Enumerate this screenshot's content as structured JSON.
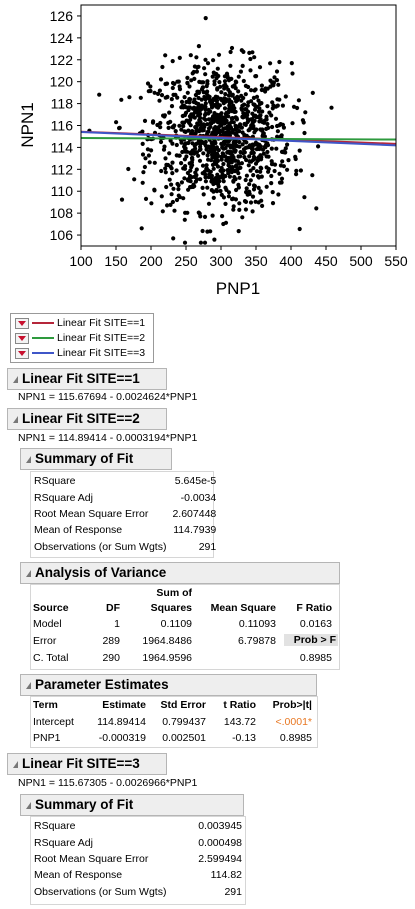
{
  "chart_data": {
    "type": "scatter",
    "xlabel": "PNP1",
    "ylabel": "NPN1",
    "xlim": [
      100,
      550
    ],
    "ylim": [
      105,
      127
    ],
    "x_ticks": [
      "100",
      "150",
      "200",
      "250",
      "300",
      "350",
      "400",
      "450",
      "500",
      "550"
    ],
    "y_ticks": [
      "106",
      "108",
      "110",
      "112",
      "114",
      "116",
      "118",
      "120",
      "122",
      "124",
      "126"
    ],
    "point_cloud": {
      "center_x": 300,
      "center_y": 115,
      "sd_x": 50,
      "sd_y": 3.3,
      "approx_points": 1100
    },
    "fit_lines": [
      {
        "name": "Linear Fit SITE==1",
        "color": "#b5263a",
        "intercept": 115.67694,
        "slope": -0.0024624
      },
      {
        "name": "Linear Fit SITE==2",
        "color": "#2e9a3e",
        "intercept": 114.89414,
        "slope": -0.0003194
      },
      {
        "name": "Linear Fit SITE==3",
        "color": "#3f56c8",
        "intercept": 115.67305,
        "slope": -0.0026966
      }
    ]
  },
  "legend": {
    "items": [
      {
        "label": "Linear Fit SITE==1",
        "color": "#b5263a"
      },
      {
        "label": "Linear Fit SITE==2",
        "color": "#2e9a3e"
      },
      {
        "label": "Linear Fit SITE==3",
        "color": "#3f56c8"
      }
    ]
  },
  "fit1": {
    "title": "Linear Fit SITE==1",
    "equation": "NPN1 = 115.67694 - 0.0024624*PNP1"
  },
  "fit2": {
    "title": "Linear Fit SITE==2",
    "equation": "NPN1 = 114.89414 - 0.0003194*PNP1",
    "summary": {
      "title": "Summary of Fit",
      "rows": [
        {
          "label": "RSquare",
          "value": "5.645e-5"
        },
        {
          "label": "RSquare Adj",
          "value": "-0.0034"
        },
        {
          "label": "Root Mean Square Error",
          "value": "2.607448"
        },
        {
          "label": "Mean of Response",
          "value": "114.7939"
        },
        {
          "label": "Observations (or Sum Wgts)",
          "value": "291"
        }
      ]
    },
    "anova": {
      "title": "Analysis of Variance",
      "headers": {
        "source": "Source",
        "df": "DF",
        "ss_top": "Sum of",
        "ss_bottom": "Squares",
        "ms": "Mean Square",
        "f": "F Ratio",
        "prob": "Prob > F"
      },
      "rows": [
        {
          "source": "Model",
          "df": "1",
          "ss": "0.1109",
          "ms": "0.11093",
          "f": "0.0163"
        },
        {
          "source": "Error",
          "df": "289",
          "ss": "1964.8486",
          "ms": "6.79878",
          "f": ""
        },
        {
          "source": "C. Total",
          "df": "290",
          "ss": "1964.9596",
          "ms": "",
          "f": "0.8985"
        }
      ]
    },
    "params": {
      "title": "Parameter Estimates",
      "headers": {
        "term": "Term",
        "est": "Estimate",
        "se": "Std Error",
        "t": "t Ratio",
        "p": "Prob>|t|"
      },
      "rows": [
        {
          "term": "Intercept",
          "est": "114.89414",
          "se": "0.799437",
          "t": "143.72",
          "p": "<.0001*"
        },
        {
          "term": "PNP1",
          "est": "-0.000319",
          "se": "0.002501",
          "t": "-0.13",
          "p": "0.8985"
        }
      ]
    }
  },
  "fit3": {
    "title": "Linear Fit SITE==3",
    "equation": "NPN1 = 115.67305 - 0.0026966*PNP1",
    "summary": {
      "title": "Summary of Fit",
      "rows": [
        {
          "label": "RSquare",
          "value": "0.003945"
        },
        {
          "label": "RSquare Adj",
          "value": "0.000498"
        },
        {
          "label": "Root Mean Square Error",
          "value": "2.599494"
        },
        {
          "label": "Mean of Response",
          "value": "114.82"
        },
        {
          "label": "Observations (or Sum Wgts)",
          "value": "291"
        }
      ]
    }
  }
}
